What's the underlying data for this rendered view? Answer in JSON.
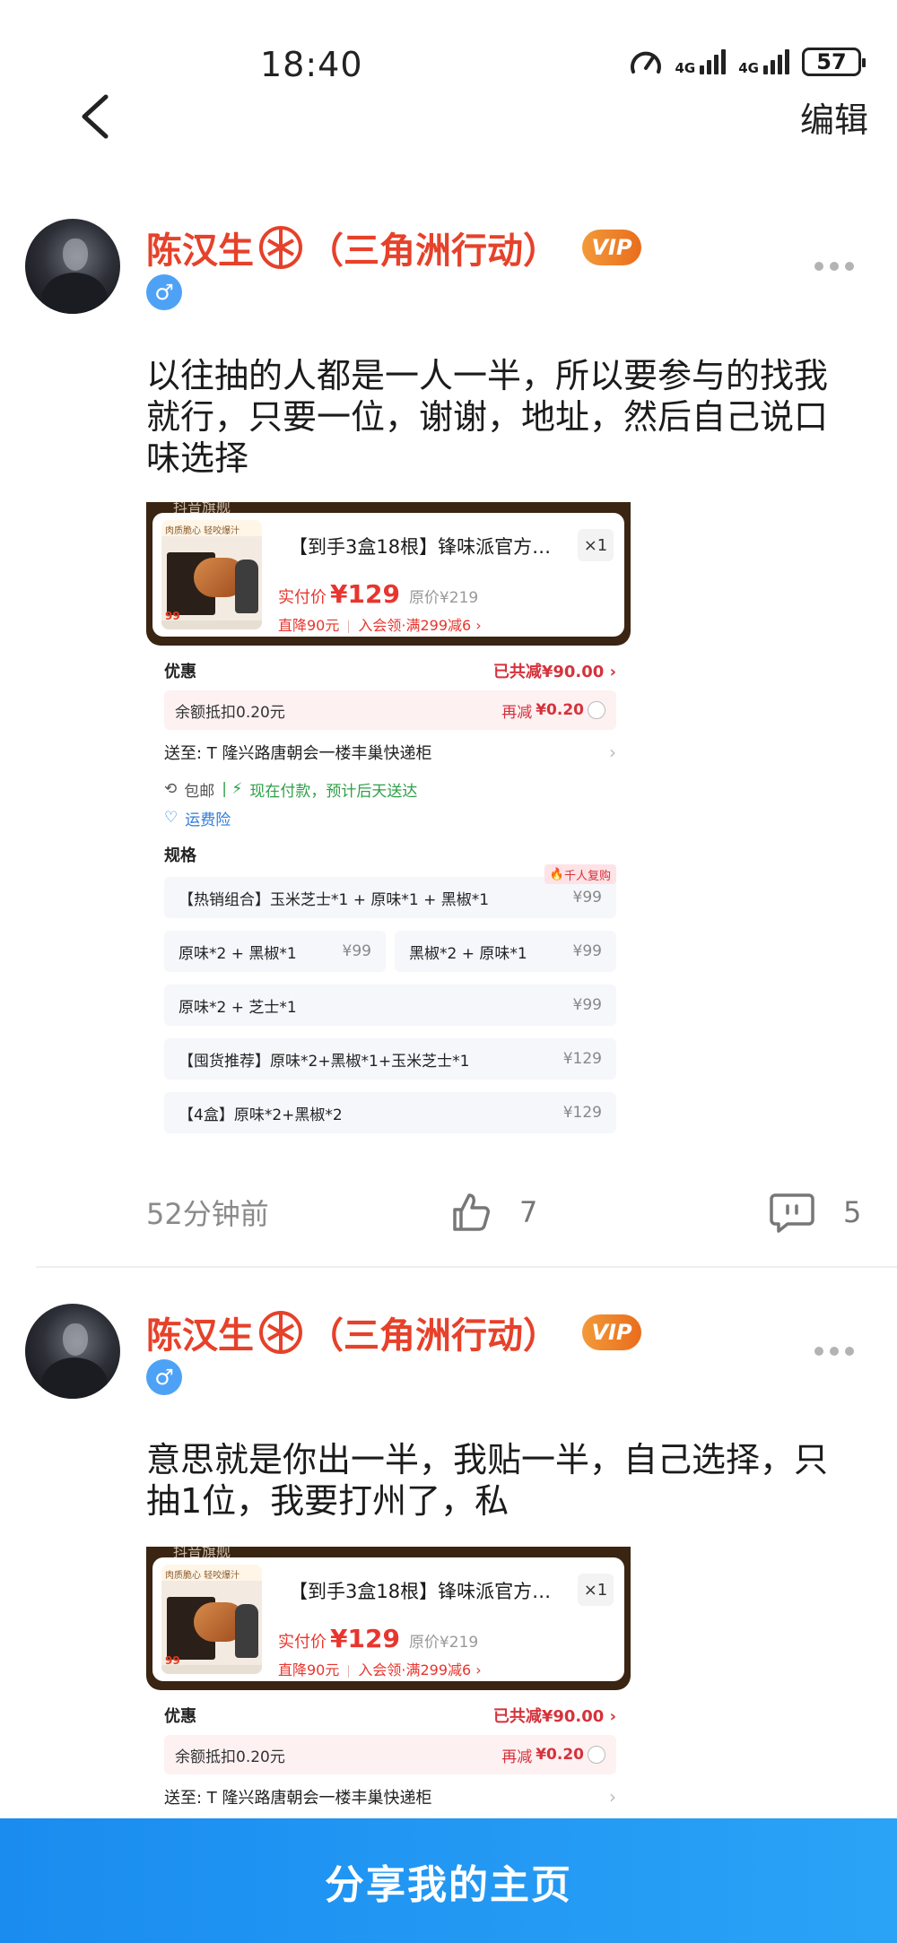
{
  "status": {
    "time": "18:40",
    "net1": "4G",
    "net2": "4G",
    "battery": "57"
  },
  "nav": {
    "edit_label": "编辑"
  },
  "posts": [
    {
      "author": "陈汉生",
      "author_suffix": "（三角洲行动）",
      "vip": "VIP",
      "gender_icon": "♂",
      "text": "以往抽的人都是一人一半，所以要参与的找我就行，只要一位，谢谢，地址，然后自己说口味选择",
      "time_ago": "52分钟前",
      "likes": "7",
      "comments": "5"
    },
    {
      "author": "陈汉生",
      "author_suffix": "（三角洲行动）",
      "vip": "VIP",
      "gender_icon": "♂",
      "text": "意思就是你出一半，我贴一半，自己选择，只抽1位，我要打州了，私"
    }
  ],
  "order": {
    "top_faded": "抖音旗舰",
    "thumb_tag": "肉质脆心 轻咬爆汁",
    "thumb_price": "99",
    "product_title": "【到手3盒18根】锋味派官方…",
    "qty": "×1",
    "pay_label": "实付价",
    "pay_value": "¥129",
    "orig_price": "原价¥219",
    "direct_discount": "直降90元",
    "member_discount": "入会领·满299减6",
    "discount_label": "优惠",
    "discount_total": "已共减¥90.00",
    "balance_label": "余额抵扣0.20元",
    "balance_value_prefix": "再减",
    "balance_value": "¥0.20",
    "ship_to": "送至: T 隆兴路唐朝会一楼丰巢快递柜",
    "free_ship": "包邮",
    "ship_eta": "现在付款，预计后天送达",
    "insurance": "运费险",
    "spec_label": "规格",
    "hot_badge": "千人复购",
    "options": [
      {
        "label": "【热销组合】玉米芝士*1 + 原味*1 + 黑椒*1",
        "price": "¥99"
      },
      {
        "label": "原味*2 + 黑椒*1",
        "price": "¥99"
      },
      {
        "label": "黑椒*2 + 原味*1",
        "price": "¥99"
      },
      {
        "label": "原味*2 + 芝士*1",
        "price": "¥99"
      },
      {
        "label": "【囤货推荐】原味*2+黑椒*1+玉米芝士*1",
        "price": "¥129"
      },
      {
        "label": "【4盒】原味*2+黑椒*2",
        "price": "¥129"
      }
    ]
  },
  "footer": {
    "share_label": "分享我的主页"
  },
  "colors": {
    "name_red": "#e6412a",
    "share_blue": "#1a8cf0",
    "vip_orange": "#ea6d1c"
  }
}
